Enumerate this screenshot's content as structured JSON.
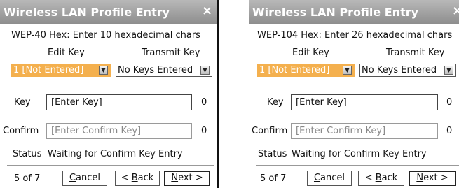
{
  "left": {
    "title": "Wireless LAN Profile Entry",
    "close": "×",
    "instruction": "WEP-40 Hex: Enter 10 hexadecimal chars",
    "edit_key_label": "Edit Key",
    "transmit_key_label": "Transmit Key",
    "edit_key_value": "1 [Not Entered]",
    "transmit_key_value": "No Keys Entered",
    "key_label": "Key",
    "key_value": "[Enter Key]",
    "key_count": "0",
    "confirm_label": "Confirm",
    "confirm_placeholder": "[Enter Confirm Key]",
    "confirm_count": "0",
    "status_label": "Status",
    "status_text": "Waiting for Confirm Key Entry",
    "step": "5 of 7",
    "cancel": {
      "pre": "",
      "u": "C",
      "post": "ancel"
    },
    "back": {
      "pre": "< ",
      "u": "B",
      "post": "ack"
    },
    "next": {
      "pre": "",
      "u": "N",
      "post": "ext >"
    }
  },
  "right": {
    "title": "Wireless LAN Profile Entry",
    "close": "×",
    "instruction": "WEP-104 Hex: Enter 26 hexadecimal chars",
    "edit_key_label": "Edit Key",
    "transmit_key_label": "Transmit Key",
    "edit_key_value": "1 [Not Entered]",
    "transmit_key_value": "No Keys Entered",
    "key_label": "Key",
    "key_value": "[Enter Key]",
    "key_count": "0",
    "confirm_label": "Confirm",
    "confirm_placeholder": "[Enter Confirm Key]",
    "confirm_count": "0",
    "status_label": "Status",
    "status_text": "Waiting for Confirm Key Entry",
    "step": "5 of 7",
    "cancel": {
      "pre": "",
      "u": "C",
      "post": "ancel"
    },
    "back": {
      "pre": "< ",
      "u": "B",
      "post": "ack"
    },
    "next": {
      "pre": "",
      "u": "N",
      "post": "ext >"
    }
  },
  "icons": {
    "close": "close-icon",
    "dropdown": "chevron-down-icon"
  },
  "colors": {
    "titlebar": "#9f9f9f",
    "highlight": "#f4b04e"
  }
}
